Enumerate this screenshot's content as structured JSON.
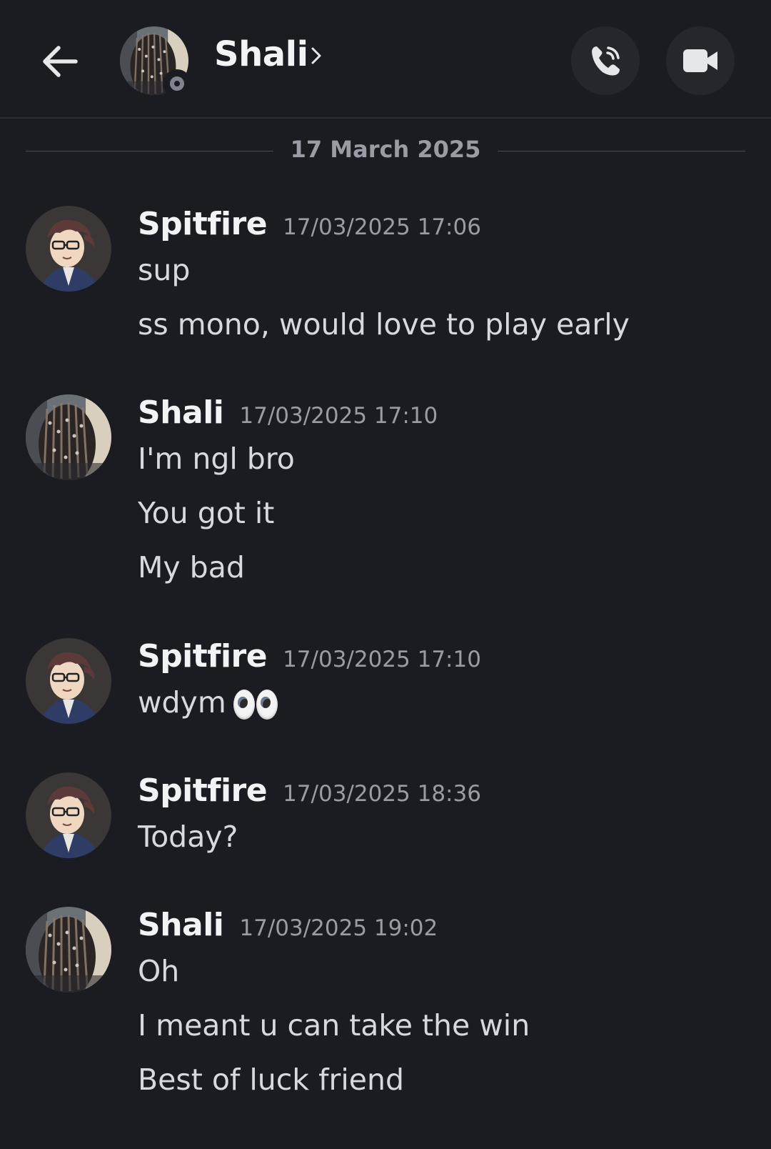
{
  "header": {
    "contact_name": "Shali",
    "status": "offline",
    "icons": {
      "back": "arrow-left-icon",
      "chevron": "chevron-right-icon",
      "call": "phone-call-icon",
      "video": "video-camera-icon"
    }
  },
  "date_separator": "17 March 2025",
  "messages": [
    {
      "author": "Spitfire",
      "timestamp": "17/03/2025 17:06",
      "lines": [
        "sup",
        "ss mono, would love to play early"
      ]
    },
    {
      "author": "Shali",
      "timestamp": "17/03/2025 17:10",
      "lines": [
        "I'm ngl bro",
        "You got it",
        "My bad"
      ]
    },
    {
      "author": "Spitfire",
      "timestamp": "17/03/2025 17:10",
      "lines": [
        "wdym"
      ],
      "emoji": "eyes"
    },
    {
      "author": "Spitfire",
      "timestamp": "17/03/2025 18:36",
      "lines": [
        "Today?"
      ]
    },
    {
      "author": "Shali",
      "timestamp": "17/03/2025 19:02",
      "lines": [
        "Oh",
        "I meant u can take the win",
        "Best of luck friend"
      ]
    }
  ],
  "colors": {
    "background": "#1b1c21",
    "button_bg": "#26272d",
    "author": "#f2f3f5",
    "timestamp": "#9a9ca5",
    "message_text": "#d8d9de"
  }
}
